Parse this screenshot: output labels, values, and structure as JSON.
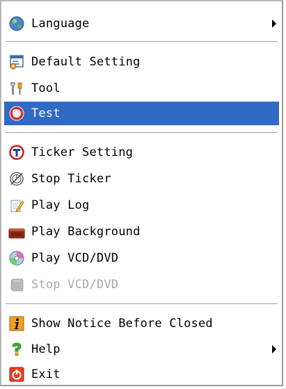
{
  "menu": {
    "language": "Language",
    "default_setting": "Default Setting",
    "tool": "Tool",
    "test": "Test",
    "ticker_setting": "Ticker Setting",
    "stop_ticker": "Stop Ticker",
    "play_log": "Play Log",
    "play_background": "Play Background",
    "play_vcd_dvd": "Play VCD/DVD",
    "stop_vcd_dvd": "Stop VCD/DVD",
    "show_notice": "Show Notice Before Closed",
    "help": "Help",
    "exit": "Exit"
  },
  "icons": {
    "language": "globe-icon",
    "default_setting": "settings-window-icon",
    "tool": "tools-icon",
    "test": "test-icon",
    "ticker_setting": "ticker-setting-icon",
    "stop_ticker": "stop-ticker-icon",
    "play_log": "log-icon",
    "play_background": "background-icon",
    "play_vcd_dvd": "disc-icon",
    "stop_vcd_dvd": "stop-disc-icon",
    "show_notice": "info-icon",
    "help": "help-icon",
    "exit": "exit-icon"
  },
  "colors": {
    "highlight": "#316ac5",
    "disabled_text": "#a8a8a8"
  }
}
